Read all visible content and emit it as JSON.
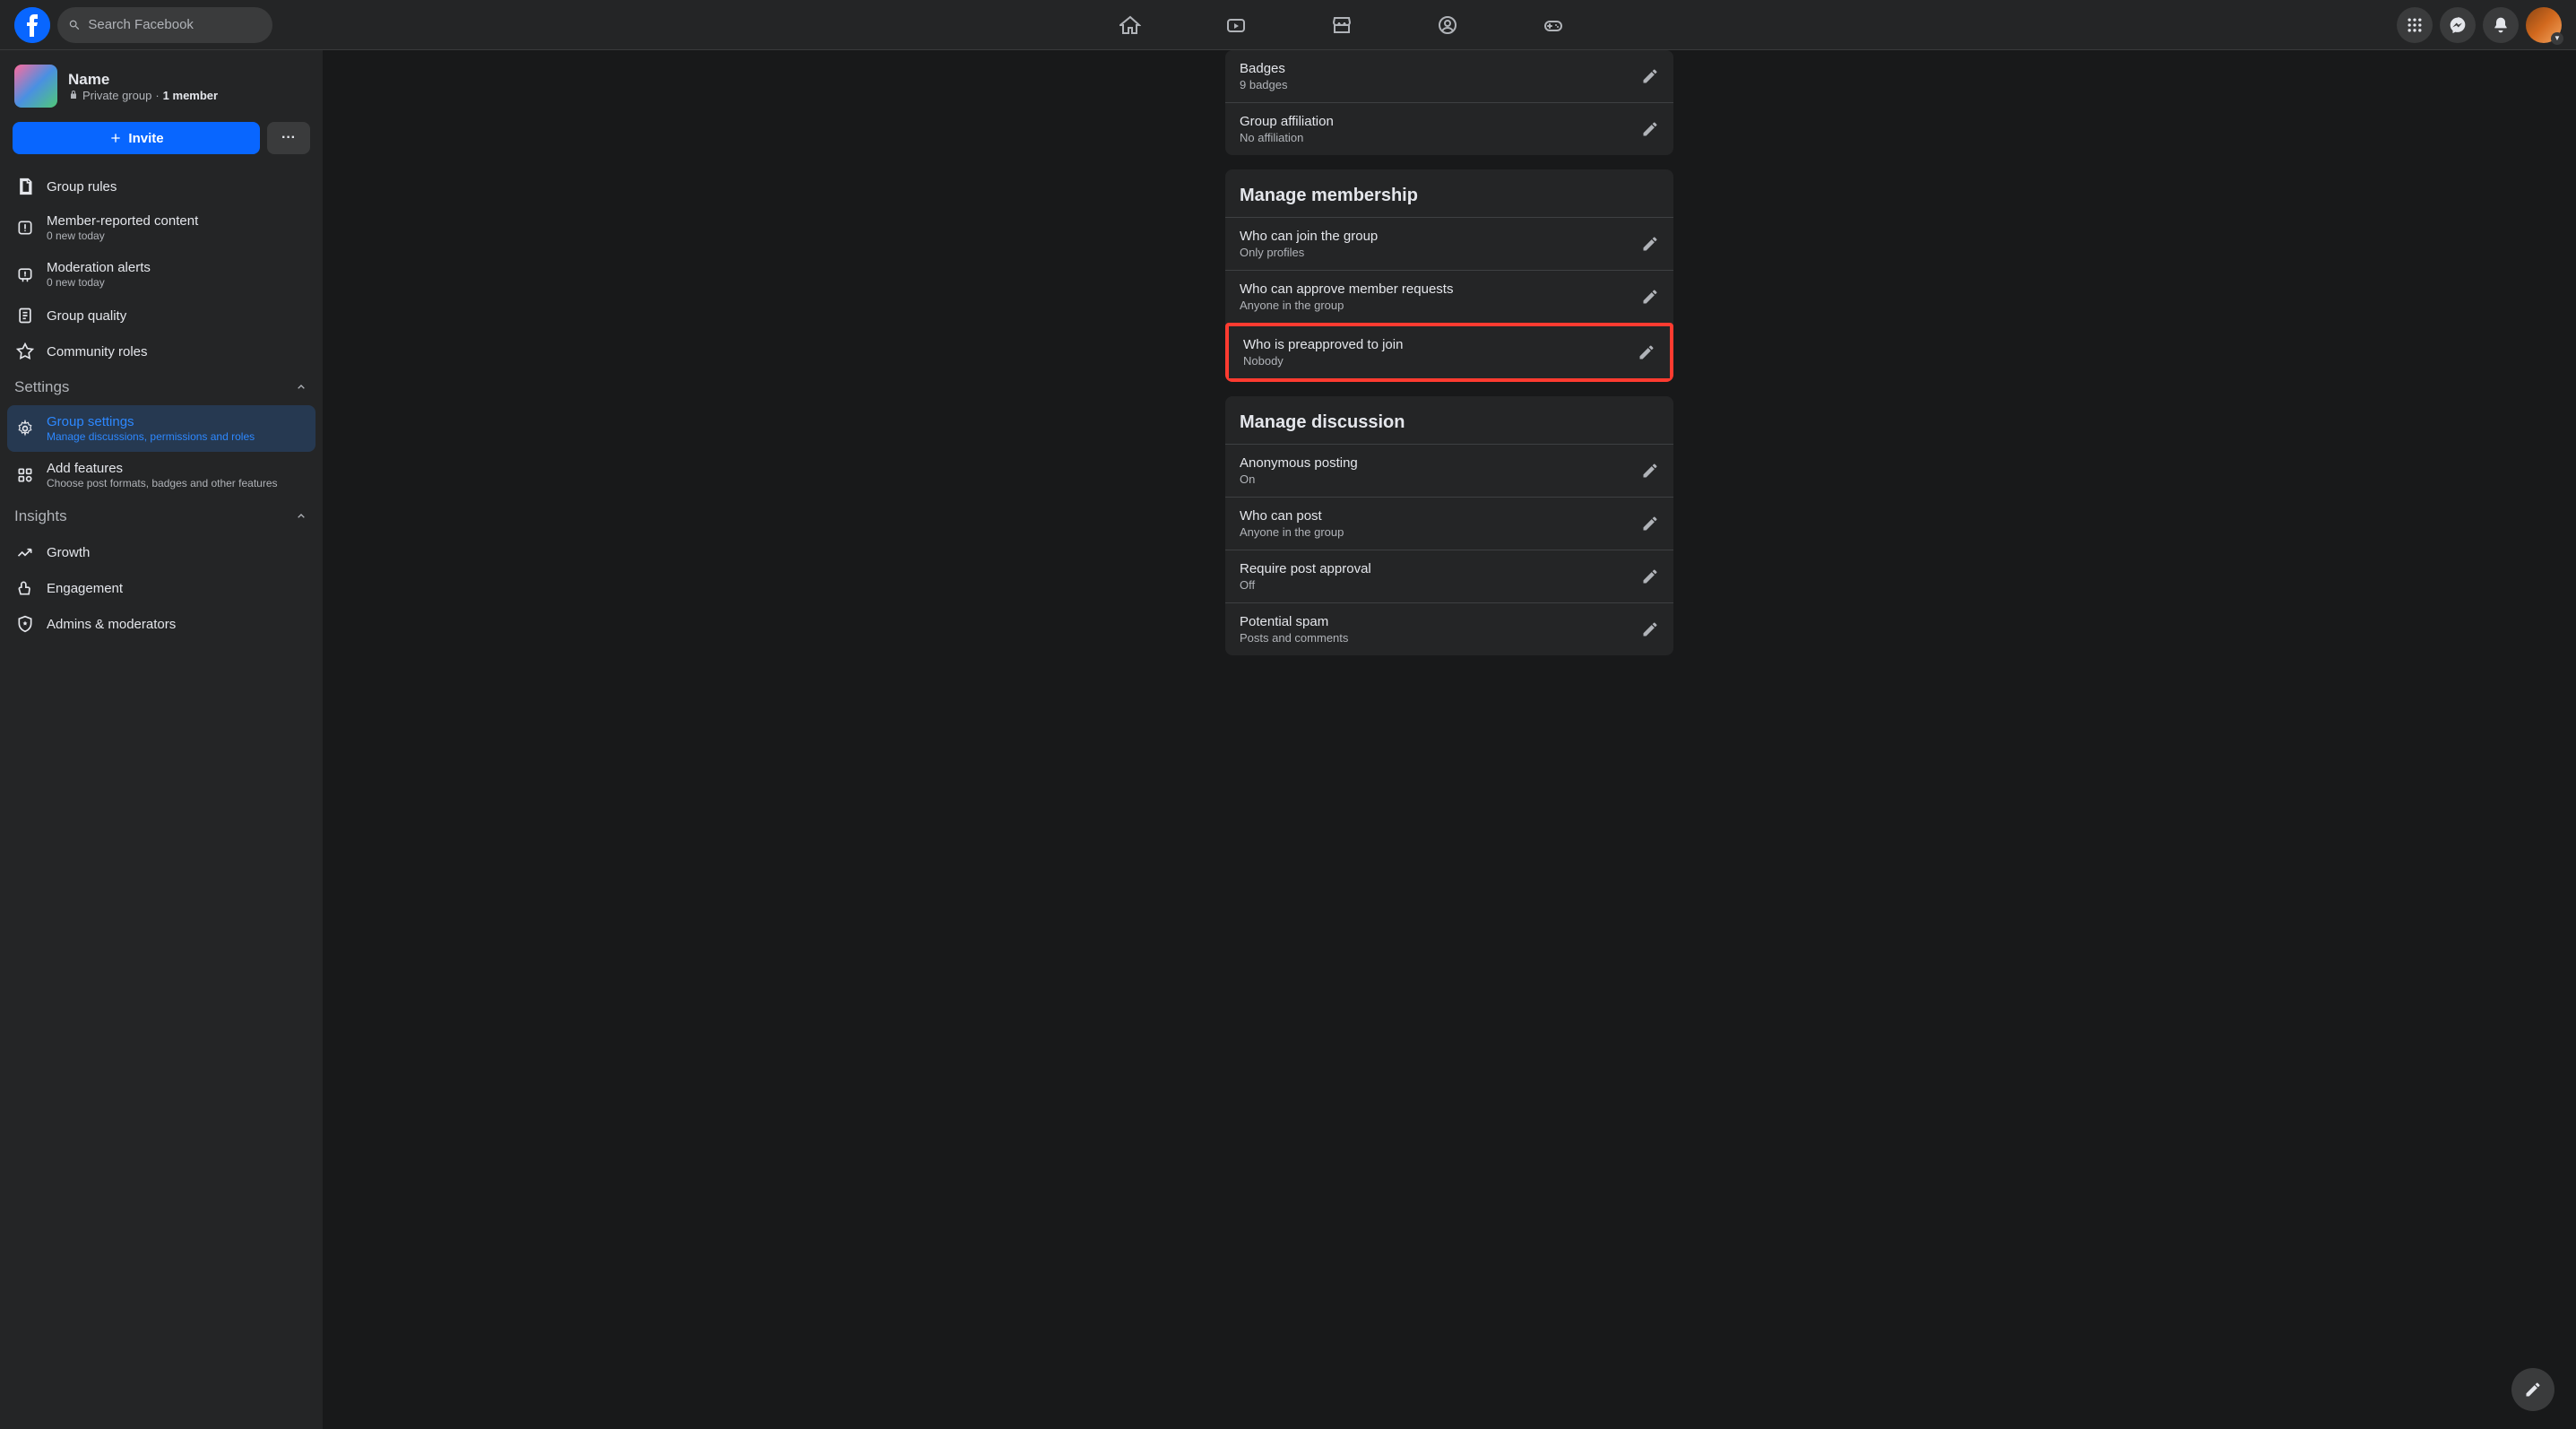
{
  "search": {
    "placeholder": "Search Facebook"
  },
  "group": {
    "name": "Name",
    "privacy": "Private group",
    "members": "1 member",
    "invite_label": "Invite"
  },
  "sidebar": {
    "items": [
      {
        "title": "Group rules",
        "sub": ""
      },
      {
        "title": "Member-reported content",
        "sub": "0 new today"
      },
      {
        "title": "Moderation alerts",
        "sub": "0 new today"
      },
      {
        "title": "Group quality",
        "sub": ""
      },
      {
        "title": "Community roles",
        "sub": ""
      }
    ],
    "settings_header": "Settings",
    "settings": [
      {
        "title": "Group settings",
        "sub": "Manage discussions, permissions and roles"
      },
      {
        "title": "Add features",
        "sub": "Choose post formats, badges and other features"
      }
    ],
    "insights_header": "Insights",
    "insights": [
      {
        "title": "Growth"
      },
      {
        "title": "Engagement"
      },
      {
        "title": "Admins & moderators"
      }
    ]
  },
  "cards": {
    "card1": {
      "rows": [
        {
          "label": "Badges",
          "value": "9 badges"
        },
        {
          "label": "Group affiliation",
          "value": "No affiliation"
        }
      ]
    },
    "membership": {
      "title": "Manage membership",
      "rows": [
        {
          "label": "Who can join the group",
          "value": "Only profiles"
        },
        {
          "label": "Who can approve member requests",
          "value": "Anyone in the group"
        },
        {
          "label": "Who is preapproved to join",
          "value": "Nobody"
        }
      ]
    },
    "discussion": {
      "title": "Manage discussion",
      "rows": [
        {
          "label": "Anonymous posting",
          "value": "On"
        },
        {
          "label": "Who can post",
          "value": "Anyone in the group"
        },
        {
          "label": "Require post approval",
          "value": "Off"
        },
        {
          "label": "Potential spam",
          "value": "Posts and comments"
        }
      ]
    }
  }
}
